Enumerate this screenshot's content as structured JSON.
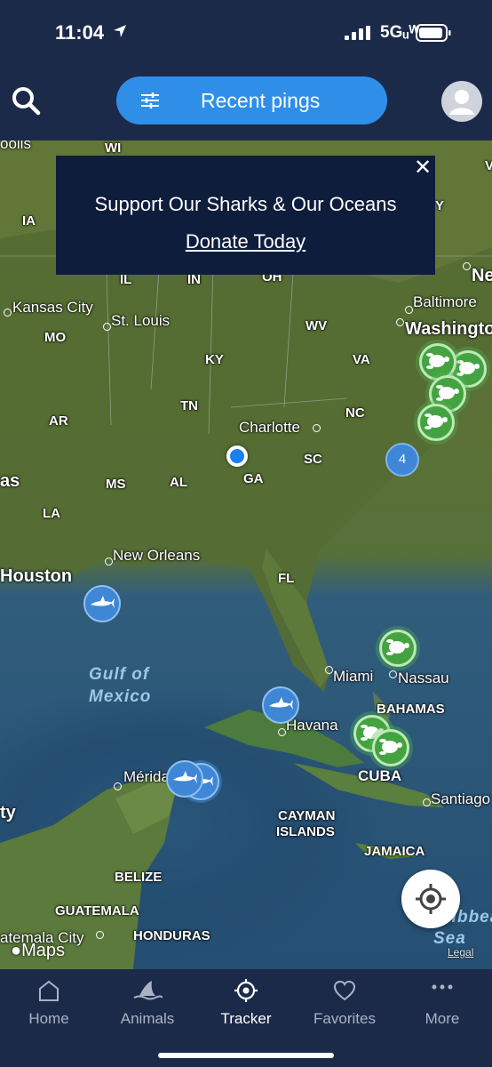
{
  "status_bar": {
    "time": "11:04",
    "network": "5Gᵤᵂ"
  },
  "header": {
    "filter_button_label": "Recent pings",
    "search_icon": "search-icon",
    "avatar_icon": "user-avatar-icon"
  },
  "banner": {
    "title": "Support Our Sharks & Our Oceans",
    "link": "Donate Today",
    "close_symbol": "✕"
  },
  "map": {
    "cities": [
      {
        "name": "Kansas City"
      },
      {
        "name": "St. Louis"
      },
      {
        "name": "Baltimore"
      },
      {
        "name": "Washington"
      },
      {
        "name": "Charlotte"
      },
      {
        "name": "New Orleans"
      },
      {
        "name": "Houston"
      },
      {
        "name": "Miami"
      },
      {
        "name": "Nassau"
      },
      {
        "name": "Havana"
      },
      {
        "name": "Mérida"
      },
      {
        "name": "Santiago"
      },
      {
        "name": "atemala City"
      },
      {
        "name": "Ne"
      },
      {
        "name": "as"
      },
      {
        "name": "ty"
      },
      {
        "name": "oolis"
      }
    ],
    "regions": [
      {
        "name": "WI"
      },
      {
        "name": "IA"
      },
      {
        "name": "IL"
      },
      {
        "name": "IN"
      },
      {
        "name": "OH"
      },
      {
        "name": "MO"
      },
      {
        "name": "KY"
      },
      {
        "name": "WV"
      },
      {
        "name": "VA"
      },
      {
        "name": "TN"
      },
      {
        "name": "NC"
      },
      {
        "name": "AR"
      },
      {
        "name": "SC"
      },
      {
        "name": "MS"
      },
      {
        "name": "AL"
      },
      {
        "name": "GA"
      },
      {
        "name": "LA"
      },
      {
        "name": "FL"
      },
      {
        "name": "BAHAMAS"
      },
      {
        "name": "CUBA"
      },
      {
        "name": "CAYMAN"
      },
      {
        "name": "ISLANDS"
      },
      {
        "name": "JAMAICA"
      },
      {
        "name": "BELIZE"
      },
      {
        "name": "GUATEMALA"
      },
      {
        "name": "HONDURAS"
      },
      {
        "name": "Y"
      },
      {
        "name": "V"
      }
    ],
    "water": [
      {
        "name": "Gulf of"
      },
      {
        "name": "Mexico"
      },
      {
        "name": "Caribbean"
      },
      {
        "name": "Sea"
      }
    ],
    "cluster_count": "4",
    "attribution": "Maps",
    "legal": "Legal"
  },
  "tabs": [
    {
      "label": "Home",
      "icon": "home-icon"
    },
    {
      "label": "Animals",
      "icon": "shark-fin-icon"
    },
    {
      "label": "Tracker",
      "icon": "crosshair-icon"
    },
    {
      "label": "Favorites",
      "icon": "heart-icon"
    },
    {
      "label": "More",
      "icon": "ellipsis-icon"
    }
  ],
  "colors": {
    "nav_bg": "#1c2a4a",
    "accent": "#2f8ee8",
    "turtle_marker": "#44a341",
    "shark_marker": "#3f87d6",
    "banner_bg": "#0f1d3d"
  }
}
